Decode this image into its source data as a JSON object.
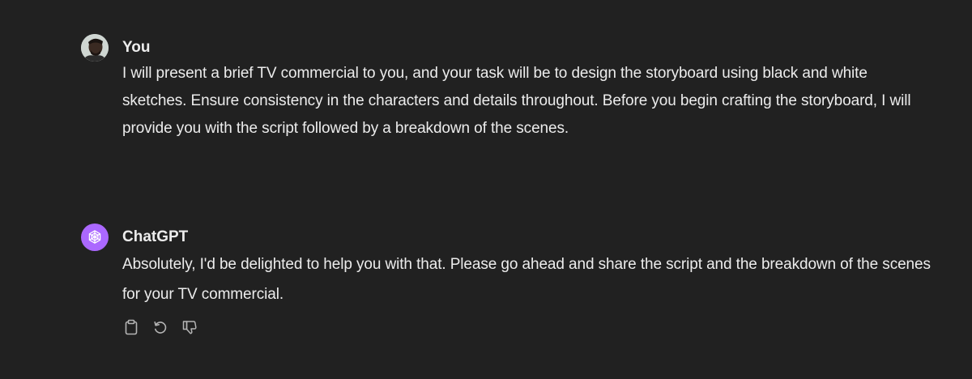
{
  "conversation": {
    "user_message": {
      "author": "You",
      "avatar": "user-photo-avatar",
      "text": "I will present a brief TV commercial to you, and your task will be to design the storyboard using black and white sketches. Ensure consistency in the characters and details throughout. Before you begin crafting the storyboard, I will provide you with the script followed by a breakdown of the scenes."
    },
    "assistant_message": {
      "author": "ChatGPT",
      "avatar": "openai-logo-icon",
      "text": "Absolutely, I'd be delighted to help you with that. Please go ahead and share the script and the breakdown of the scenes for your TV commercial.",
      "actions": [
        {
          "name": "copy",
          "icon": "clipboard-icon"
        },
        {
          "name": "regenerate",
          "icon": "regenerate-icon"
        },
        {
          "name": "dislike",
          "icon": "thumbs-down-icon"
        }
      ]
    }
  },
  "colors": {
    "background": "#212121",
    "text": "#ececec",
    "assistant_avatar": "#ab68ff",
    "icon": "#b4b4b4"
  }
}
